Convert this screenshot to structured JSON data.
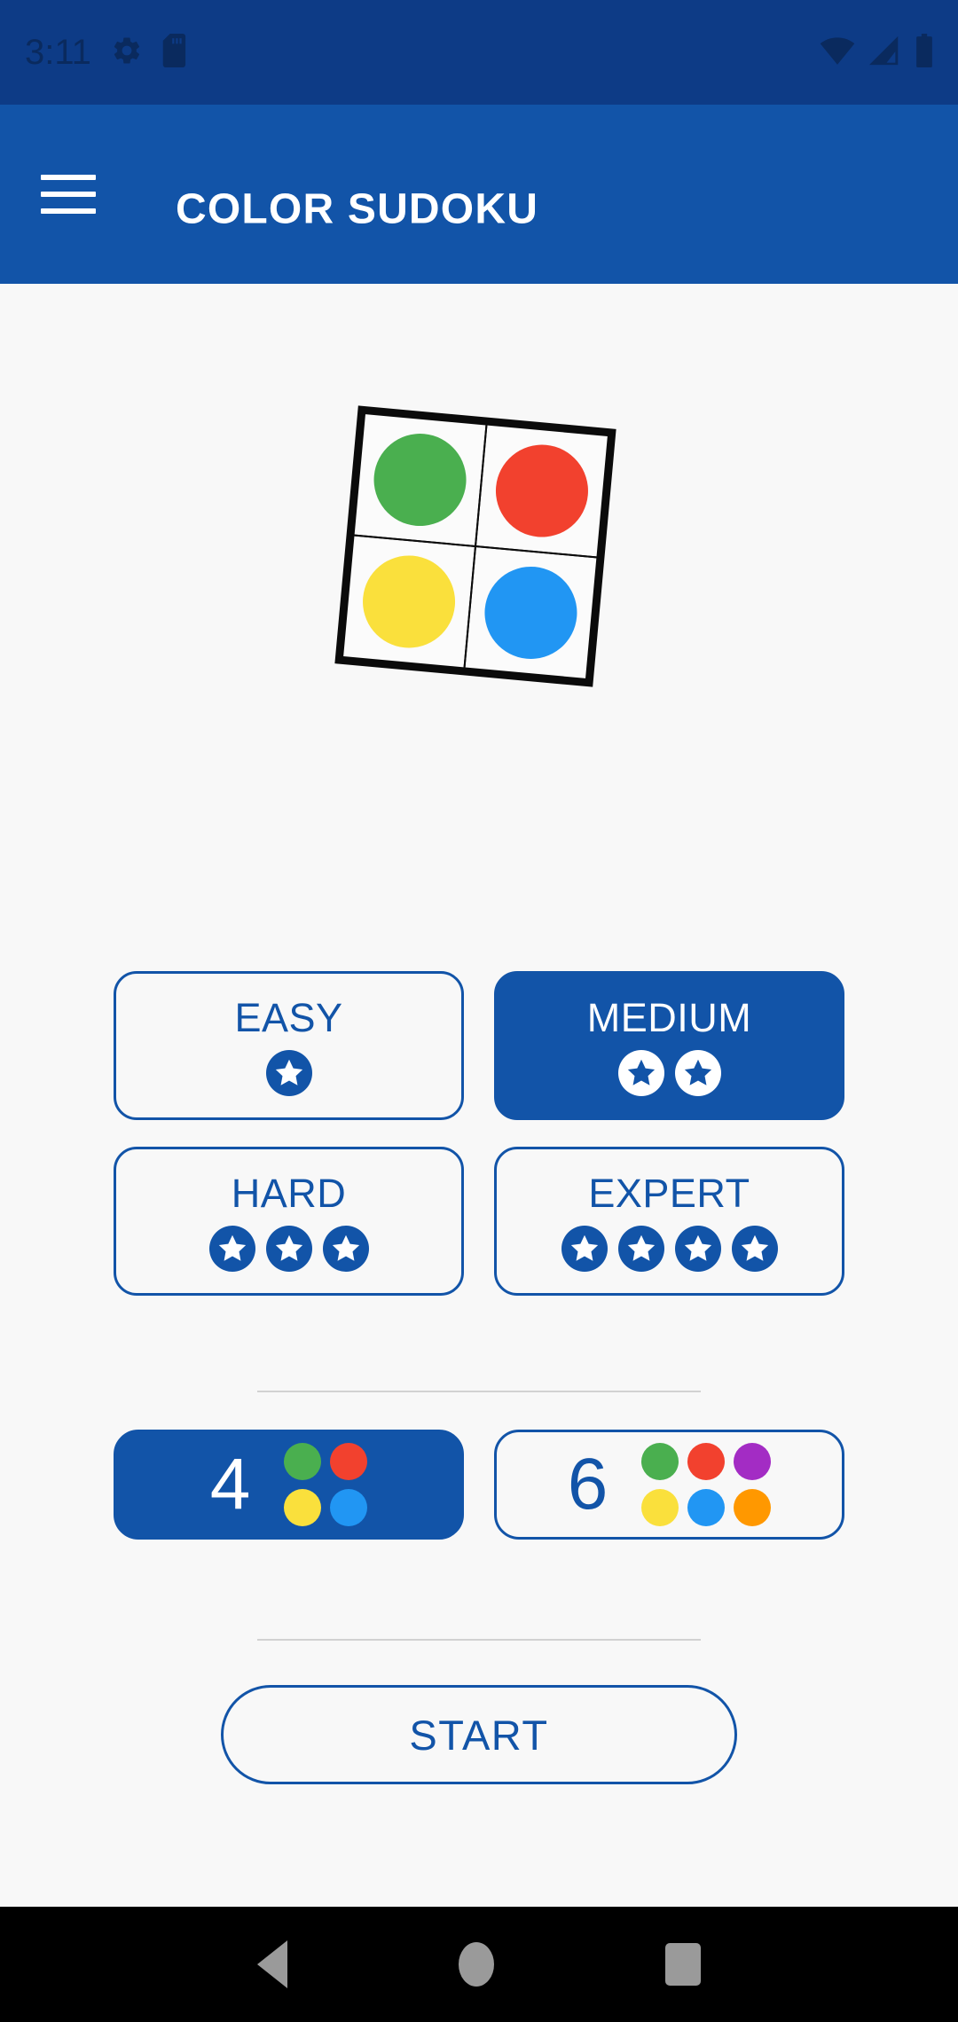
{
  "status_bar": {
    "time": "3:11",
    "left_icons": [
      "gear-icon",
      "sd-card-icon"
    ],
    "right_icons": [
      "wifi-icon",
      "cellular-signal-icon",
      "battery-icon"
    ],
    "background_color": "#0d3b86"
  },
  "app_bar": {
    "menu_icon": "hamburger-menu-icon",
    "title": "COLOR SUDOKU",
    "background_color": "#1254a8",
    "title_color": "#ffffff"
  },
  "theme": {
    "accent": "#1254a8",
    "page_background": "#f8f8f8",
    "divider": "#d2d2d2"
  },
  "logo": {
    "name": "color-sudoku-logo",
    "rotation_deg": 5.2,
    "cells": [
      {
        "position": "top-left",
        "color": "#4aaf4f"
      },
      {
        "position": "top-right",
        "color": "#f2412e"
      },
      {
        "position": "bottom-left",
        "color": "#fae03c"
      },
      {
        "position": "bottom-right",
        "color": "#2196f3"
      }
    ]
  },
  "difficulty": {
    "options": [
      {
        "id": "easy",
        "label": "EASY",
        "stars": 1,
        "selected": false
      },
      {
        "id": "medium",
        "label": "MEDIUM",
        "stars": 2,
        "selected": true
      },
      {
        "id": "hard",
        "label": "HARD",
        "stars": 3,
        "selected": false
      },
      {
        "id": "expert",
        "label": "EXPERT",
        "stars": 4,
        "selected": false
      }
    ]
  },
  "size": {
    "options": [
      {
        "id": "size-4",
        "label": "4",
        "selected": true,
        "colors": [
          "#4aaf4f",
          "#f2412e",
          "#fae03c",
          "#2196f3"
        ],
        "columns": 2
      },
      {
        "id": "size-6",
        "label": "6",
        "selected": false,
        "colors": [
          "#4aaf4f",
          "#f2412e",
          "#a32cc4",
          "#fae03c",
          "#2196f3",
          "#ff9800"
        ],
        "columns": 3
      }
    ]
  },
  "start_button": {
    "label": "START"
  },
  "nav_bar": {
    "background_color": "#000000",
    "icon_color": "#9a9a9a",
    "buttons": [
      "back-icon",
      "home-icon",
      "recents-icon"
    ]
  }
}
